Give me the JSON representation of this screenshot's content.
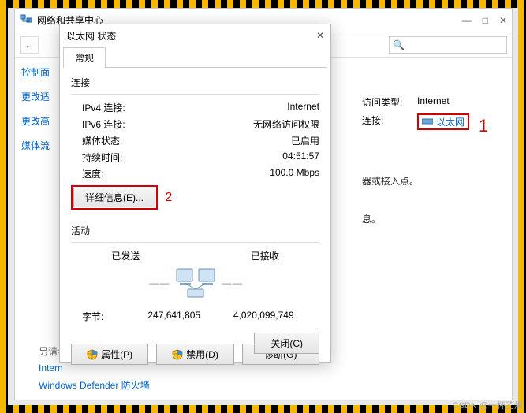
{
  "main_window": {
    "title": "网络和共享中心",
    "sidebar": {
      "items": [
        "控制面",
        "更改适",
        "更改高",
        "媒体流"
      ]
    },
    "right": {
      "access_type_label": "访问类型:",
      "access_type_value": "Internet",
      "connection_label": "连接:",
      "connection_value": "以太网",
      "note_1": "器或接入点。",
      "note_2": "息。"
    },
    "footer": {
      "see_also": "另请参",
      "internet_options": "Intern",
      "defender": "Windows Defender 防火墙"
    }
  },
  "annotations": {
    "one": "1",
    "two": "2"
  },
  "dialog": {
    "title": "以太网 状态",
    "tab_general": "常规",
    "section_connection": "连接",
    "rows": {
      "ipv4_label": "IPv4 连接:",
      "ipv4_value": "Internet",
      "ipv6_label": "IPv6 连接:",
      "ipv6_value": "无网络访问权限",
      "media_label": "媒体状态:",
      "media_value": "已启用",
      "duration_label": "持续时间:",
      "duration_value": "04:51:57",
      "speed_label": "速度:",
      "speed_value": "100.0 Mbps"
    },
    "details_button": "详细信息(E)...",
    "section_activity": "活动",
    "activity": {
      "sent_label": "已发送",
      "received_label": "已接收",
      "bytes_label": "字节:",
      "bytes_sent": "247,641,805",
      "bytes_received": "4,020,099,749"
    },
    "buttons": {
      "properties": "属性(P)",
      "disable": "禁用(D)",
      "diagnose": "诊断(G)",
      "close": "关闭(C)"
    }
  },
  "watermark": "CSDN @一杯乙烯"
}
